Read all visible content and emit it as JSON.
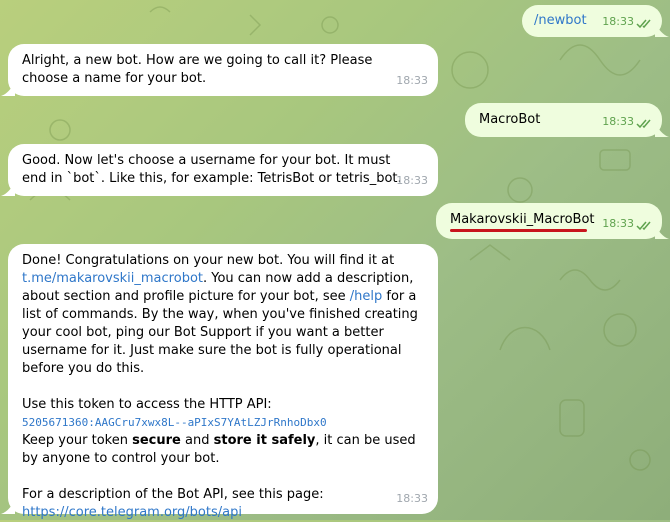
{
  "messages": [
    {
      "text": "/newbot",
      "time": "18:33"
    },
    {
      "text": "Alright, a new bot. How are we going to call it? Please choose a name for your bot.",
      "time": "18:33"
    },
    {
      "text": "MacroBot",
      "time": "18:33"
    },
    {
      "text": "Good. Now let's choose a username for your bot. It must end in `bot`. Like this, for example: TetrisBot or tetris_bot.",
      "time": "18:33"
    },
    {
      "text": "Makarovskii_MacroBot",
      "time": "18:33"
    },
    {
      "time": "18:33",
      "p1_a": "Done! Congratulations on your new bot. You will find it at",
      "link_bot": "t.me/makarovskii_macrobot",
      "p1_b": ". You can now add a description, about section and profile picture for your bot, see",
      "link_help": "/help",
      "p1_c": "for a list of commands. By the way, when you've finished creating your cool bot, ping our Bot Support if you want a better username for it. Just make sure the bot is fully operational before you do this.",
      "p2_label": "Use this token to access the HTTP API:",
      "token": "5205671360:AAGCru7xwx8L--aPIxS7YAtLZJrRnhoDbx0",
      "p2_a": "Keep your token",
      "p2_secure": "secure",
      "p2_and": "and",
      "p2_store": "store it safely",
      "p2_b": ", it can be used by anyone to control your bot.",
      "p3_label": "For a description of the Bot API, see this page:",
      "link_api": "https://core.telegram.org/bots/api"
    }
  ],
  "colors": {
    "outgoing_bubble": "#effdde",
    "incoming_bubble": "#ffffff",
    "link": "#2f77c9",
    "check": "#5fa24e",
    "highlight_underline": "#c8161d"
  }
}
